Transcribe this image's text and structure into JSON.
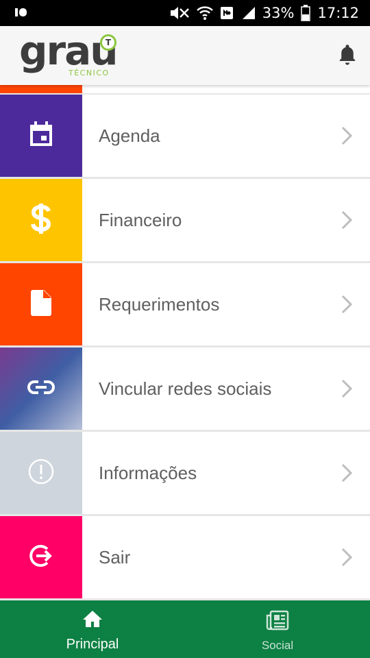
{
  "status_bar": {
    "battery_percent": "33%",
    "time": "17:12",
    "icons": [
      "notification-icon",
      "mute-icon",
      "wifi-icon",
      "nfc-icon",
      "signal-icon",
      "battery-icon"
    ]
  },
  "header": {
    "logo_word": "grau",
    "logo_sub": "TÉCNICO",
    "logo_badge": "T",
    "colors": {
      "logo_green": "#8cc63f",
      "logo_dark": "#3d3d3d"
    }
  },
  "menu": {
    "items": [
      {
        "label": "Agenda",
        "icon": "calendar-icon",
        "color": "#4d2a9c"
      },
      {
        "label": "Financeiro",
        "icon": "dollar-icon",
        "color": "#ffc400"
      },
      {
        "label": "Requerimentos",
        "icon": "document-icon",
        "color": "#ff4500"
      },
      {
        "label": "Vincular redes sociais",
        "icon": "link-icon",
        "color": "#3f5ea4"
      },
      {
        "label": "Informações",
        "icon": "info-alert-icon",
        "color": "#ced5dc"
      },
      {
        "label": "Sair",
        "icon": "logout-icon",
        "color": "#ff0066"
      }
    ]
  },
  "bottom_nav": {
    "items": [
      {
        "label": "Principal",
        "icon": "home-icon",
        "active": true
      },
      {
        "label": "Social",
        "icon": "newspaper-icon",
        "active": false
      }
    ],
    "color": "#0d8043"
  }
}
